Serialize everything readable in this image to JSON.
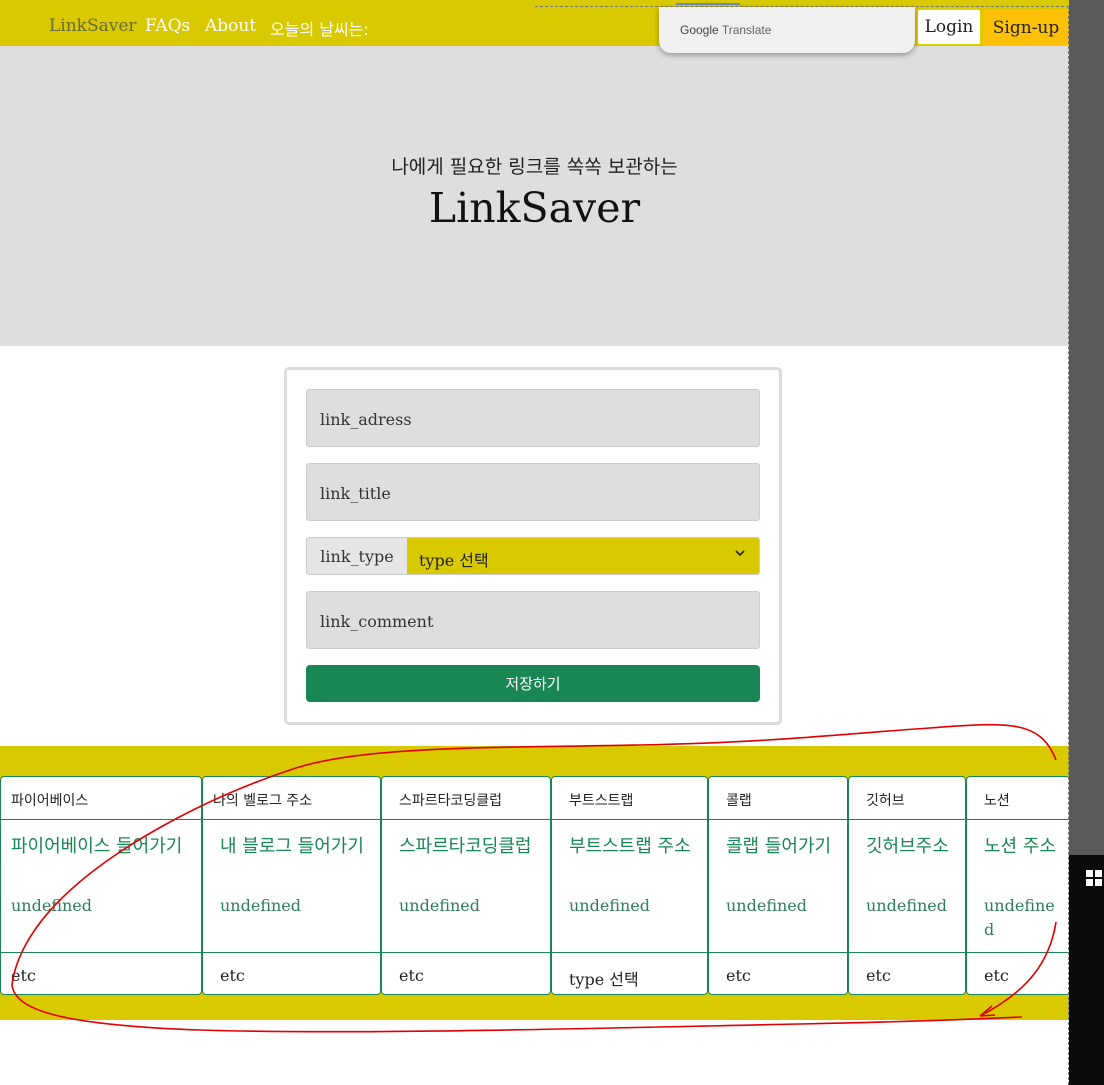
{
  "navbar": {
    "brand": "LinkSaver",
    "links": [
      "FAQs",
      "About",
      "오늘의 날씨는:"
    ],
    "login_label": "Login",
    "signup_label": "Sign-up"
  },
  "translate_popup": {
    "google": "Google",
    "translate": "Translate"
  },
  "hero": {
    "subtitle": "나에게 필요한 링크를 쏙쏙 보관하는",
    "title": "LinkSaver"
  },
  "form": {
    "link_address_placeholder": "link_adress",
    "link_title_placeholder": "link_title",
    "link_type_label": "link_type",
    "link_type_selected": "type 선택",
    "link_comment_placeholder": "link_comment",
    "save_label": "저장하기"
  },
  "cards": [
    {
      "header": "파이어베이스",
      "title": "파이어베이스 들어가기",
      "comment": "undefined",
      "type": "etc"
    },
    {
      "header": "나의 벨로그 주소",
      "title": "내 블로그 들어가기",
      "comment": "undefined",
      "type": "etc"
    },
    {
      "header": "스파르타코딩클럽",
      "title": "스파르타코딩클럽",
      "comment": "undefined",
      "type": "etc"
    },
    {
      "header": "부트스트랩",
      "title": "부트스트랩 주소",
      "comment": "undefined",
      "type": "type 선택"
    },
    {
      "header": "콜랩",
      "title": "콜랩 들어가기",
      "comment": "undefined",
      "type": "etc"
    },
    {
      "header": "깃허브",
      "title": "깃허브주소",
      "comment": "undefined",
      "type": "etc"
    },
    {
      "header": "노션",
      "title": "노션 주소",
      "comment": "undefined",
      "type": "etc"
    }
  ],
  "colors": {
    "accent_yellow": "#d9c900",
    "success_green": "#198754",
    "signup_orange": "#ffc107",
    "annotation_red": "#e00000"
  },
  "icons": {
    "select_chevron": "chevron-down-icon",
    "taskbar": "windows-logo-icon"
  }
}
